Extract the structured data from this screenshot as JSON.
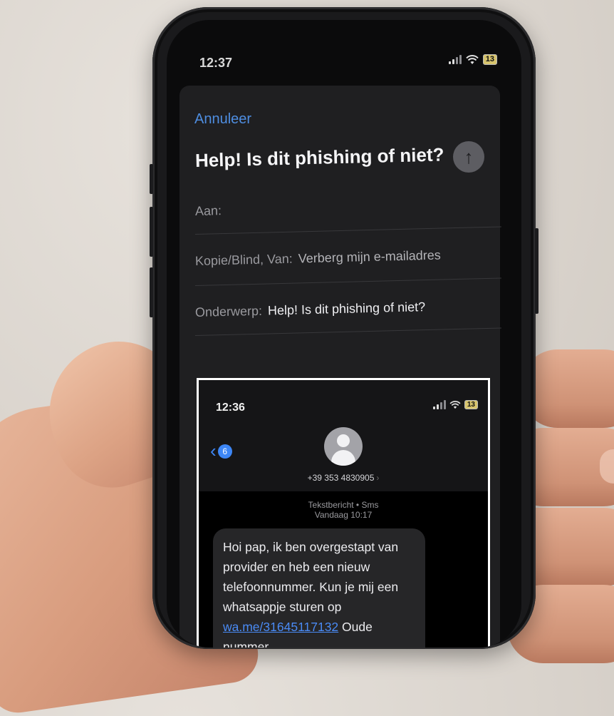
{
  "phone_status": {
    "time": "12:37",
    "battery": "13"
  },
  "mail": {
    "cancel_label": "Annuleer",
    "title": "Help! Is dit phishing of niet?",
    "to_label": "Aan:",
    "cc_label": "Kopie/Blind, Van:",
    "cc_value": "Verberg mijn e-mailadres",
    "subject_label": "Onderwerp:",
    "subject_value": "Help! Is dit phishing of niet?"
  },
  "attachment_screenshot": {
    "time": "12:36",
    "battery": "13",
    "back_badge": "6",
    "contact_number": "+39 353 4830905",
    "message_type": "Tekstbericht • Sms",
    "message_date": "Vandaag 10:17",
    "message_text_before_link": "Hoi pap, ik ben overgestapt van provider en heb een nieuw telefoonnummer. Kun je mij een whatsappje sturen op ",
    "message_link": "wa.me/31645117132",
    "message_text_after_link": " Oude nummer"
  },
  "icons": [
    "send-arrow-icon",
    "signal-icon",
    "wifi-icon",
    "battery-icon",
    "back-chevron-icon",
    "avatar-icon"
  ]
}
